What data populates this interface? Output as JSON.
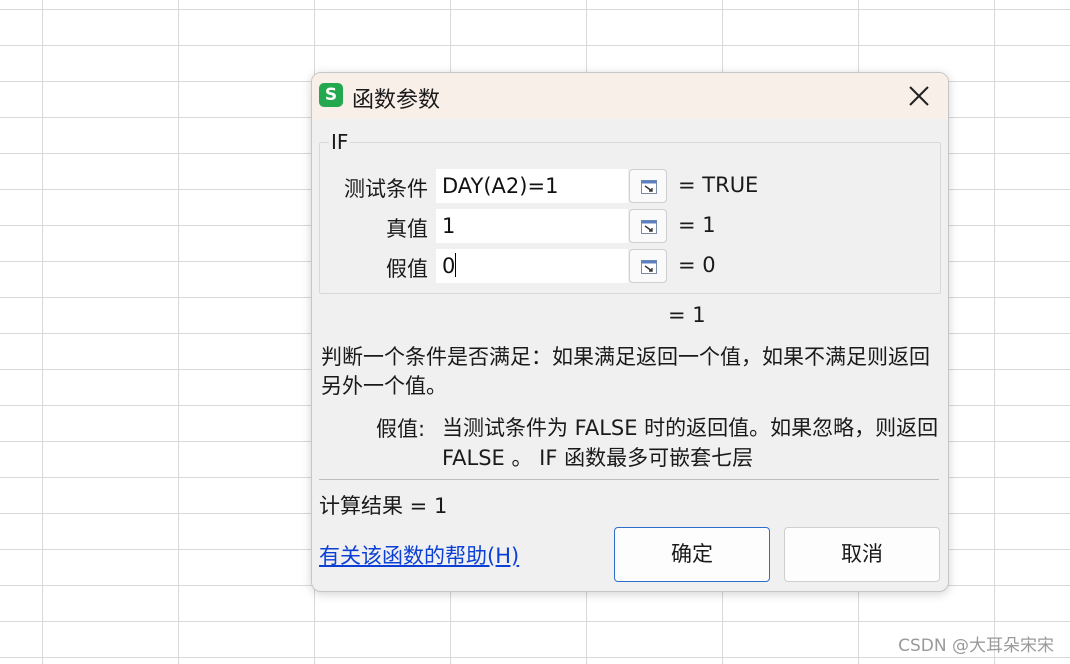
{
  "dialog": {
    "title": "函数参数",
    "app_icon": "S",
    "group_name": "IF",
    "args": [
      {
        "label": "测试条件",
        "value": "DAY(A2)=1",
        "result": "= TRUE"
      },
      {
        "label": "真值",
        "value": "1",
        "result": "= 1"
      },
      {
        "label": "假值",
        "value": "0",
        "result": "= 0"
      }
    ],
    "formula_result": "= 1",
    "description": "判断一个条件是否满足：如果满足返回一个值，如果不满足则返回另外一个值。",
    "param_label": "假值:",
    "param_description": "当测试条件为 FALSE 时的返回值。如果忽略，则返回 FALSE 。 IF 函数最多可嵌套七层",
    "calc_result": "计算结果 = 1",
    "help_link": "有关该函数的帮助(H)",
    "ok_label": "确定",
    "cancel_label": "取消"
  },
  "watermark": "CSDN @大耳朵宋宋",
  "colors": {
    "titlebar_bg": "#f8efe9",
    "dialog_bg": "#f0f0f0",
    "app_icon_green": "#23a84f",
    "link_blue": "#0b3fd6",
    "primary_border": "#2c6fc9"
  },
  "icons": {
    "close": "close-icon",
    "ref": "range-select-icon"
  }
}
